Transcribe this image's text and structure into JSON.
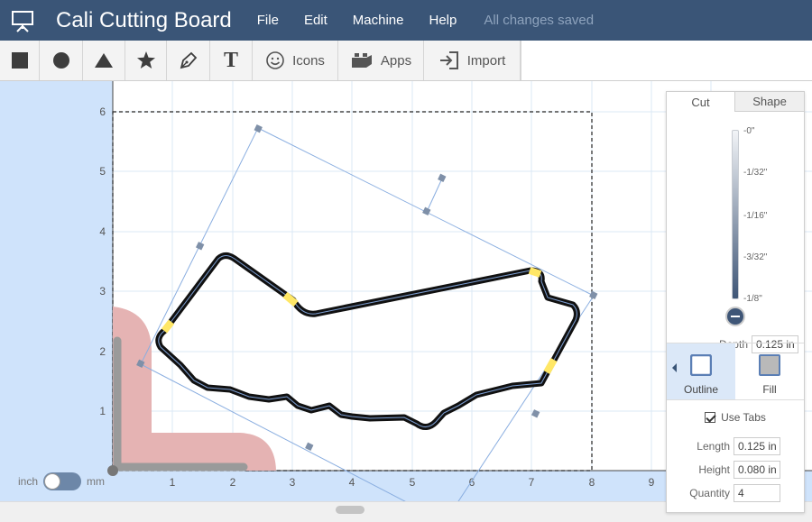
{
  "header": {
    "title": "Cali Cutting Board",
    "menu": [
      {
        "id": "file",
        "label": "File"
      },
      {
        "id": "edit",
        "label": "Edit"
      },
      {
        "id": "machine",
        "label": "Machine"
      },
      {
        "id": "help",
        "label": "Help"
      }
    ],
    "save_status": "All changes saved",
    "logo_icon": "easel-icon",
    "bg_color": "#3a5577"
  },
  "toolbar": {
    "tools": [
      {
        "id": "square",
        "icon": "square-icon"
      },
      {
        "id": "circle",
        "icon": "circle-icon"
      },
      {
        "id": "triangle",
        "icon": "triangle-icon"
      },
      {
        "id": "star",
        "icon": "star-icon"
      },
      {
        "id": "pen",
        "icon": "pen-icon"
      },
      {
        "id": "text",
        "icon": "text-icon",
        "glyph": "T"
      }
    ],
    "icons_label": "Icons",
    "apps_label": "Apps",
    "import_label": "Import"
  },
  "canvas": {
    "x_ticks": [
      "1",
      "2",
      "3",
      "4",
      "5",
      "6",
      "7",
      "8",
      "9"
    ],
    "y_ticks": [
      "1",
      "2",
      "3",
      "4",
      "5",
      "6"
    ],
    "accent_color": "#7d9fd3",
    "tab_marker_color": "#ffe766"
  },
  "unit_toggle": {
    "left": "inch",
    "right": "mm",
    "selected": "inch"
  },
  "panel": {
    "tabs": {
      "cut": "Cut",
      "shape": "Shape",
      "active": "cut"
    },
    "depth_scale": {
      "l0": "-0\"",
      "l1": "-1/32\"",
      "l2": "-1/16\"",
      "l3": "-3/32\"",
      "l4": "-1/8\""
    },
    "depth_label": "Depth",
    "depth_value": "0.125 in",
    "modes": {
      "outline": "Outline",
      "fill": "Fill",
      "active": "outline"
    },
    "use_tabs_label": "Use Tabs",
    "use_tabs_checked": true,
    "length_label": "Length",
    "length_value": "0.125 in",
    "height_label": "Height",
    "height_value": "0.080 in",
    "quantity_label": "Quantity",
    "quantity_value": "4"
  }
}
